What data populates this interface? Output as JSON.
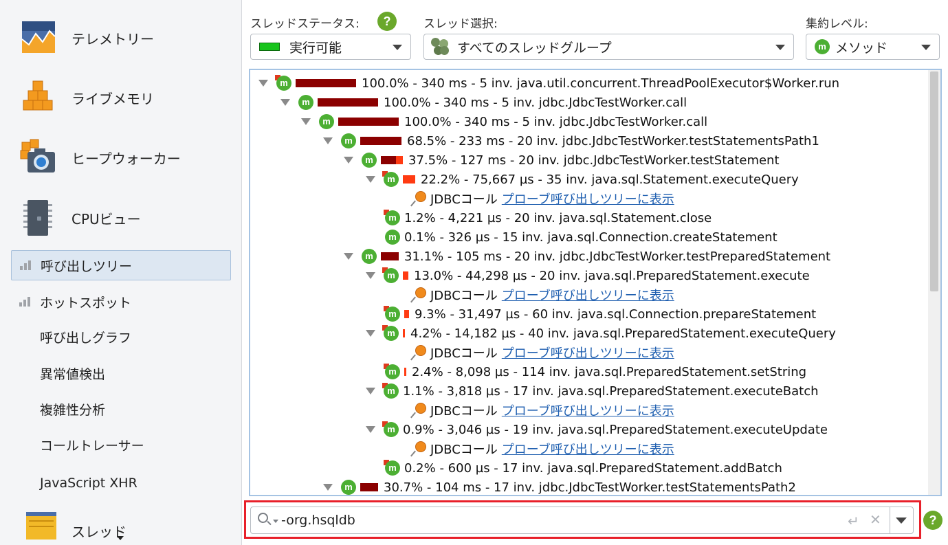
{
  "sidebar": {
    "big_items": [
      {
        "label": "テレメトリー",
        "icon": "telemetry-icon"
      },
      {
        "label": "ライブメモリ",
        "icon": "live-memory-icon"
      },
      {
        "label": "ヒープウォーカー",
        "icon": "heap-walker-icon"
      },
      {
        "label": "CPUビュー",
        "icon": "cpu-chip-icon"
      }
    ],
    "sub_items": [
      {
        "label": "呼び出しツリー",
        "selected": true
      },
      {
        "label": "ホットスポット",
        "selected": false
      }
    ],
    "plain_items": [
      "呼び出しグラフ",
      "異常値検出",
      "複雑性分析",
      "コールトレーサー",
      "JavaScript XHR"
    ],
    "partial_item": {
      "label": "スレッド",
      "icon": "threads-icon"
    }
  },
  "toolbar": {
    "thread_status_label": "スレッドステータス:",
    "thread_status_value": "実行可能",
    "thread_select_label": "スレッド選択:",
    "thread_select_value": "すべてのスレッドグループ",
    "aggregation_label": "集約レベル:",
    "aggregation_value": "メソッド",
    "help_glyph": "?"
  },
  "tree": {
    "rows": [
      {
        "text": "100.0% - 340 ms - 5 inv. java.util.concurrent.ThreadPoolExecutor$Worker.run",
        "expanded": true
      },
      {
        "text": "100.0% - 340 ms - 5 inv. jdbc.JdbcTestWorker.call",
        "expanded": true
      },
      {
        "text": "100.0% - 340 ms - 5 inv. jdbc.JdbcTestWorker.call",
        "expanded": true
      },
      {
        "text": "68.5% - 233 ms - 20 inv. jdbc.JdbcTestWorker.testStatementsPath1",
        "expanded": true
      },
      {
        "text": "37.5% - 127 ms - 20 inv. jdbc.JdbcTestWorker.testStatement",
        "expanded": true
      },
      {
        "text": "22.2% - 75,667 µs - 35 inv. java.sql.Statement.executeQuery",
        "expanded": true
      },
      {
        "probe_label": "JDBCコール",
        "probe_link": "プローブ呼び出しツリーに表示"
      },
      {
        "text": "1.2% - 4,221 µs - 20 inv. java.sql.Statement.close"
      },
      {
        "text": "0.1% - 326 µs - 15 inv. java.sql.Connection.createStatement"
      },
      {
        "text": "31.1% - 105 ms - 20 inv. jdbc.JdbcTestWorker.testPreparedStatement",
        "expanded": true
      },
      {
        "text": "13.0% - 44,298 µs - 20 inv. java.sql.PreparedStatement.execute",
        "expanded": true
      },
      {
        "probe_label": "JDBCコール",
        "probe_link": "プローブ呼び出しツリーに表示"
      },
      {
        "text": "9.3% - 31,497 µs - 60 inv. java.sql.Connection.prepareStatement"
      },
      {
        "text": "4.2% - 14,182 µs - 40 inv. java.sql.PreparedStatement.executeQuery",
        "expanded": true
      },
      {
        "probe_label": "JDBCコール",
        "probe_link": "プローブ呼び出しツリーに表示"
      },
      {
        "text": "2.4% - 8,098 µs - 114 inv. java.sql.PreparedStatement.setString"
      },
      {
        "text": "1.1% - 3,818 µs - 17 inv. java.sql.PreparedStatement.executeBatch",
        "expanded": true
      },
      {
        "probe_label": "JDBCコール",
        "probe_link": "プローブ呼び出しツリーに表示"
      },
      {
        "text": "0.9% - 3,046 µs - 19 inv. java.sql.PreparedStatement.executeUpdate",
        "expanded": true
      },
      {
        "probe_label": "JDBCコール",
        "probe_link": "プローブ呼び出しツリーに表示"
      },
      {
        "text": "0.2% - 600 µs - 17 inv. java.sql.PreparedStatement.addBatch"
      },
      {
        "text": "30.7% - 104 ms - 17 inv. jdbc.JdbcTestWorker.testStatementsPath2",
        "expanded": true
      }
    ]
  },
  "filter": {
    "value": "-org.hsqldb"
  },
  "colors": {
    "bar_dark": "#8b0000",
    "bar_red": "#ff3b12",
    "method_icon": "#4caf33",
    "highlight_outline": "#e8202a",
    "selection": "#dde7f2"
  }
}
